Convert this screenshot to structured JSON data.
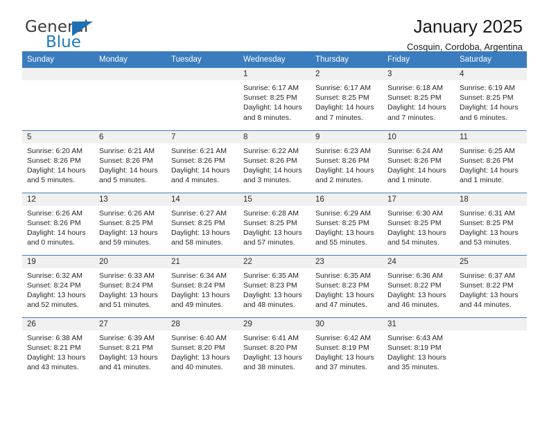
{
  "brand": {
    "line1": "General",
    "line2": "Blue",
    "triangle_color": "#1f6fb5"
  },
  "header": {
    "title": "January 2025",
    "subtitle": "Cosquin, Cordoba, Argentina"
  },
  "theme": {
    "header_row_color": "#3a7cbe",
    "daynum_band_color": "#f0f0f0",
    "text_color": "#262626"
  },
  "labels": {
    "sunrise_prefix": "Sunrise:",
    "sunset_prefix": "Sunset:",
    "daylight_prefix": "Daylight:"
  },
  "weekdays": [
    "Sunday",
    "Monday",
    "Tuesday",
    "Wednesday",
    "Thursday",
    "Friday",
    "Saturday"
  ],
  "weeks": [
    [
      {
        "day": "",
        "blank": true,
        "sunrise": "",
        "sunset": "",
        "daylight_line1": "",
        "daylight_line2": ""
      },
      {
        "day": "",
        "blank": true,
        "sunrise": "",
        "sunset": "",
        "daylight_line1": "",
        "daylight_line2": ""
      },
      {
        "day": "",
        "blank": true,
        "sunrise": "",
        "sunset": "",
        "daylight_line1": "",
        "daylight_line2": ""
      },
      {
        "day": "1",
        "sunrise": "Sunrise: 6:17 AM",
        "sunset": "Sunset: 8:25 PM",
        "daylight_line1": "Daylight: 14 hours",
        "daylight_line2": "and 8 minutes."
      },
      {
        "day": "2",
        "sunrise": "Sunrise: 6:17 AM",
        "sunset": "Sunset: 8:25 PM",
        "daylight_line1": "Daylight: 14 hours",
        "daylight_line2": "and 7 minutes."
      },
      {
        "day": "3",
        "sunrise": "Sunrise: 6:18 AM",
        "sunset": "Sunset: 8:25 PM",
        "daylight_line1": "Daylight: 14 hours",
        "daylight_line2": "and 7 minutes."
      },
      {
        "day": "4",
        "sunrise": "Sunrise: 6:19 AM",
        "sunset": "Sunset: 8:25 PM",
        "daylight_line1": "Daylight: 14 hours",
        "daylight_line2": "and 6 minutes."
      }
    ],
    [
      {
        "day": "5",
        "sunrise": "Sunrise: 6:20 AM",
        "sunset": "Sunset: 8:26 PM",
        "daylight_line1": "Daylight: 14 hours",
        "daylight_line2": "and 5 minutes."
      },
      {
        "day": "6",
        "sunrise": "Sunrise: 6:21 AM",
        "sunset": "Sunset: 8:26 PM",
        "daylight_line1": "Daylight: 14 hours",
        "daylight_line2": "and 5 minutes."
      },
      {
        "day": "7",
        "sunrise": "Sunrise: 6:21 AM",
        "sunset": "Sunset: 8:26 PM",
        "daylight_line1": "Daylight: 14 hours",
        "daylight_line2": "and 4 minutes."
      },
      {
        "day": "8",
        "sunrise": "Sunrise: 6:22 AM",
        "sunset": "Sunset: 8:26 PM",
        "daylight_line1": "Daylight: 14 hours",
        "daylight_line2": "and 3 minutes."
      },
      {
        "day": "9",
        "sunrise": "Sunrise: 6:23 AM",
        "sunset": "Sunset: 8:26 PM",
        "daylight_line1": "Daylight: 14 hours",
        "daylight_line2": "and 2 minutes."
      },
      {
        "day": "10",
        "sunrise": "Sunrise: 6:24 AM",
        "sunset": "Sunset: 8:26 PM",
        "daylight_line1": "Daylight: 14 hours",
        "daylight_line2": "and 1 minute."
      },
      {
        "day": "11",
        "sunrise": "Sunrise: 6:25 AM",
        "sunset": "Sunset: 8:26 PM",
        "daylight_line1": "Daylight: 14 hours",
        "daylight_line2": "and 1 minute."
      }
    ],
    [
      {
        "day": "12",
        "sunrise": "Sunrise: 6:26 AM",
        "sunset": "Sunset: 8:26 PM",
        "daylight_line1": "Daylight: 14 hours",
        "daylight_line2": "and 0 minutes."
      },
      {
        "day": "13",
        "sunrise": "Sunrise: 6:26 AM",
        "sunset": "Sunset: 8:25 PM",
        "daylight_line1": "Daylight: 13 hours",
        "daylight_line2": "and 59 minutes."
      },
      {
        "day": "14",
        "sunrise": "Sunrise: 6:27 AM",
        "sunset": "Sunset: 8:25 PM",
        "daylight_line1": "Daylight: 13 hours",
        "daylight_line2": "and 58 minutes."
      },
      {
        "day": "15",
        "sunrise": "Sunrise: 6:28 AM",
        "sunset": "Sunset: 8:25 PM",
        "daylight_line1": "Daylight: 13 hours",
        "daylight_line2": "and 57 minutes."
      },
      {
        "day": "16",
        "sunrise": "Sunrise: 6:29 AM",
        "sunset": "Sunset: 8:25 PM",
        "daylight_line1": "Daylight: 13 hours",
        "daylight_line2": "and 55 minutes."
      },
      {
        "day": "17",
        "sunrise": "Sunrise: 6:30 AM",
        "sunset": "Sunset: 8:25 PM",
        "daylight_line1": "Daylight: 13 hours",
        "daylight_line2": "and 54 minutes."
      },
      {
        "day": "18",
        "sunrise": "Sunrise: 6:31 AM",
        "sunset": "Sunset: 8:25 PM",
        "daylight_line1": "Daylight: 13 hours",
        "daylight_line2": "and 53 minutes."
      }
    ],
    [
      {
        "day": "19",
        "sunrise": "Sunrise: 6:32 AM",
        "sunset": "Sunset: 8:24 PM",
        "daylight_line1": "Daylight: 13 hours",
        "daylight_line2": "and 52 minutes."
      },
      {
        "day": "20",
        "sunrise": "Sunrise: 6:33 AM",
        "sunset": "Sunset: 8:24 PM",
        "daylight_line1": "Daylight: 13 hours",
        "daylight_line2": "and 51 minutes."
      },
      {
        "day": "21",
        "sunrise": "Sunrise: 6:34 AM",
        "sunset": "Sunset: 8:24 PM",
        "daylight_line1": "Daylight: 13 hours",
        "daylight_line2": "and 49 minutes."
      },
      {
        "day": "22",
        "sunrise": "Sunrise: 6:35 AM",
        "sunset": "Sunset: 8:23 PM",
        "daylight_line1": "Daylight: 13 hours",
        "daylight_line2": "and 48 minutes."
      },
      {
        "day": "23",
        "sunrise": "Sunrise: 6:35 AM",
        "sunset": "Sunset: 8:23 PM",
        "daylight_line1": "Daylight: 13 hours",
        "daylight_line2": "and 47 minutes."
      },
      {
        "day": "24",
        "sunrise": "Sunrise: 6:36 AM",
        "sunset": "Sunset: 8:22 PM",
        "daylight_line1": "Daylight: 13 hours",
        "daylight_line2": "and 46 minutes."
      },
      {
        "day": "25",
        "sunrise": "Sunrise: 6:37 AM",
        "sunset": "Sunset: 8:22 PM",
        "daylight_line1": "Daylight: 13 hours",
        "daylight_line2": "and 44 minutes."
      }
    ],
    [
      {
        "day": "26",
        "sunrise": "Sunrise: 6:38 AM",
        "sunset": "Sunset: 8:21 PM",
        "daylight_line1": "Daylight: 13 hours",
        "daylight_line2": "and 43 minutes."
      },
      {
        "day": "27",
        "sunrise": "Sunrise: 6:39 AM",
        "sunset": "Sunset: 8:21 PM",
        "daylight_line1": "Daylight: 13 hours",
        "daylight_line2": "and 41 minutes."
      },
      {
        "day": "28",
        "sunrise": "Sunrise: 6:40 AM",
        "sunset": "Sunset: 8:20 PM",
        "daylight_line1": "Daylight: 13 hours",
        "daylight_line2": "and 40 minutes."
      },
      {
        "day": "29",
        "sunrise": "Sunrise: 6:41 AM",
        "sunset": "Sunset: 8:20 PM",
        "daylight_line1": "Daylight: 13 hours",
        "daylight_line2": "and 38 minutes."
      },
      {
        "day": "30",
        "sunrise": "Sunrise: 6:42 AM",
        "sunset": "Sunset: 8:19 PM",
        "daylight_line1": "Daylight: 13 hours",
        "daylight_line2": "and 37 minutes."
      },
      {
        "day": "31",
        "sunrise": "Sunrise: 6:43 AM",
        "sunset": "Sunset: 8:19 PM",
        "daylight_line1": "Daylight: 13 hours",
        "daylight_line2": "and 35 minutes."
      },
      {
        "day": "",
        "blank": true,
        "sunrise": "",
        "sunset": "",
        "daylight_line1": "",
        "daylight_line2": ""
      }
    ]
  ]
}
